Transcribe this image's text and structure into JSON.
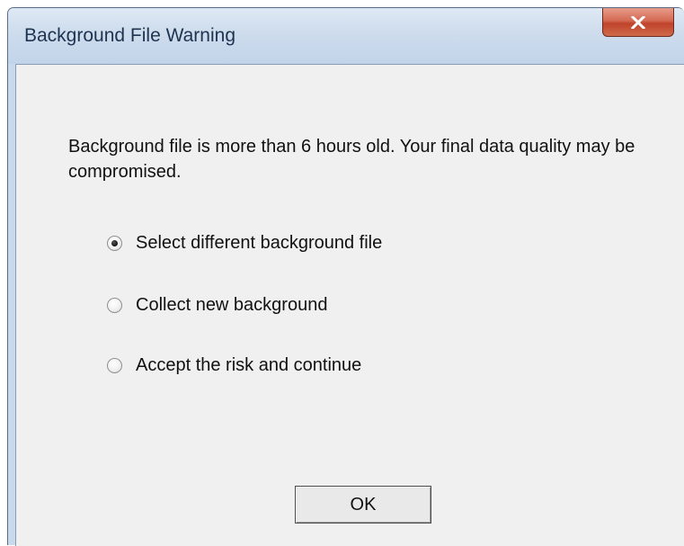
{
  "window": {
    "title": "Background File Warning"
  },
  "message": "Background file is more than 6 hours old.  Your final data quality may be compromised.",
  "options": [
    {
      "label": "Select different background file",
      "selected": true
    },
    {
      "label": "Collect new background",
      "selected": false
    },
    {
      "label": "Accept the risk and continue",
      "selected": false
    }
  ],
  "buttons": {
    "ok_label": "OK"
  },
  "icons": {
    "close": "close-icon"
  },
  "colors": {
    "close_button": "#c0432b",
    "titlebar": "#cfdded",
    "client_background": "#f0f0f0"
  }
}
